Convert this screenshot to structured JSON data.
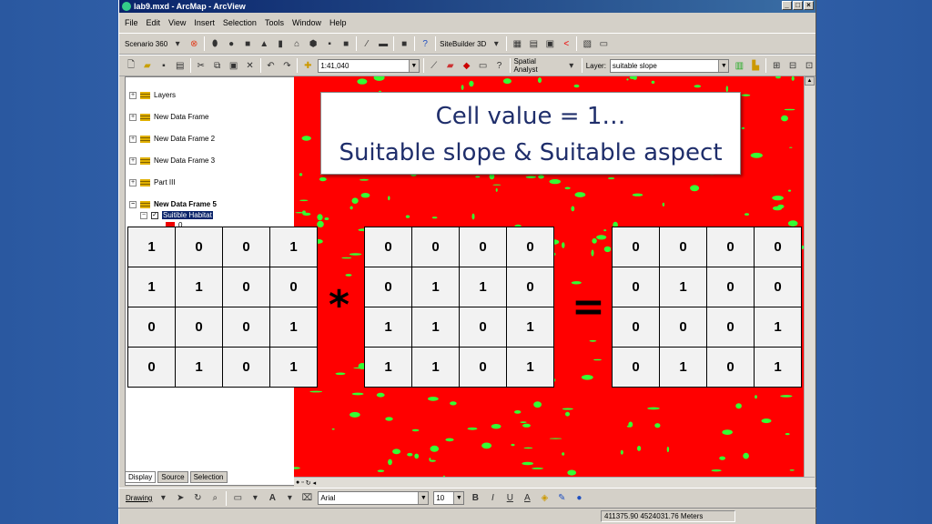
{
  "window": {
    "title": "lab9.mxd - ArcMap - ArcView",
    "min": "_",
    "max": "□",
    "close": "×"
  },
  "menubar": [
    "File",
    "Edit",
    "View",
    "Insert",
    "Selection",
    "Tools",
    "Window",
    "Help"
  ],
  "toolbar1": {
    "scenario": "Scenario 360",
    "sitebuilder": "SiteBuilder 3D"
  },
  "toolbar2": {
    "scale": "1:41,040",
    "spatial_analyst": "Spatial Analyst",
    "layer_label": "Layer:",
    "layer_value": "suitable slope"
  },
  "toc": {
    "items": [
      {
        "label": "Layers",
        "bold": false
      },
      {
        "label": "New Data Frame",
        "bold": false
      },
      {
        "label": "New Data Frame 2",
        "bold": false
      },
      {
        "label": "New Data Frame 3",
        "bold": false
      },
      {
        "label": "Part III",
        "bold": false
      },
      {
        "label": "New Data Frame 5",
        "bold": true
      }
    ],
    "selected_layer": "Suitible Habitat",
    "legend_value": "0",
    "tabs": [
      "Display",
      "Source",
      "Selection"
    ]
  },
  "callout": {
    "line1": "Cell value = 1…",
    "line2": "Suitable slope & Suitable aspect"
  },
  "grids": {
    "slope": [
      [
        "1",
        "0",
        "0",
        "1"
      ],
      [
        "1",
        "1",
        "0",
        "0"
      ],
      [
        "0",
        "0",
        "0",
        "1"
      ],
      [
        "0",
        "1",
        "0",
        "1"
      ]
    ],
    "aspect": [
      [
        "0",
        "0",
        "0",
        "0"
      ],
      [
        "0",
        "1",
        "1",
        "0"
      ],
      [
        "1",
        "1",
        "0",
        "1"
      ],
      [
        "1",
        "1",
        "0",
        "1"
      ]
    ],
    "result": [
      [
        "0",
        "0",
        "0",
        "0"
      ],
      [
        "0",
        "1",
        "0",
        "0"
      ],
      [
        "0",
        "0",
        "0",
        "1"
      ],
      [
        "0",
        "1",
        "0",
        "1"
      ]
    ]
  },
  "operators": {
    "multiply": "*",
    "equals": "="
  },
  "drawing_toolbar": {
    "drawing": "Drawing",
    "font": "Arial",
    "font_size": "10"
  },
  "status": {
    "coords": "411375.90  4524031.76 Meters"
  },
  "colors": {
    "map_red": "#ff0000",
    "map_green": "#33ff33",
    "callout_text": "#1f2e6b"
  }
}
